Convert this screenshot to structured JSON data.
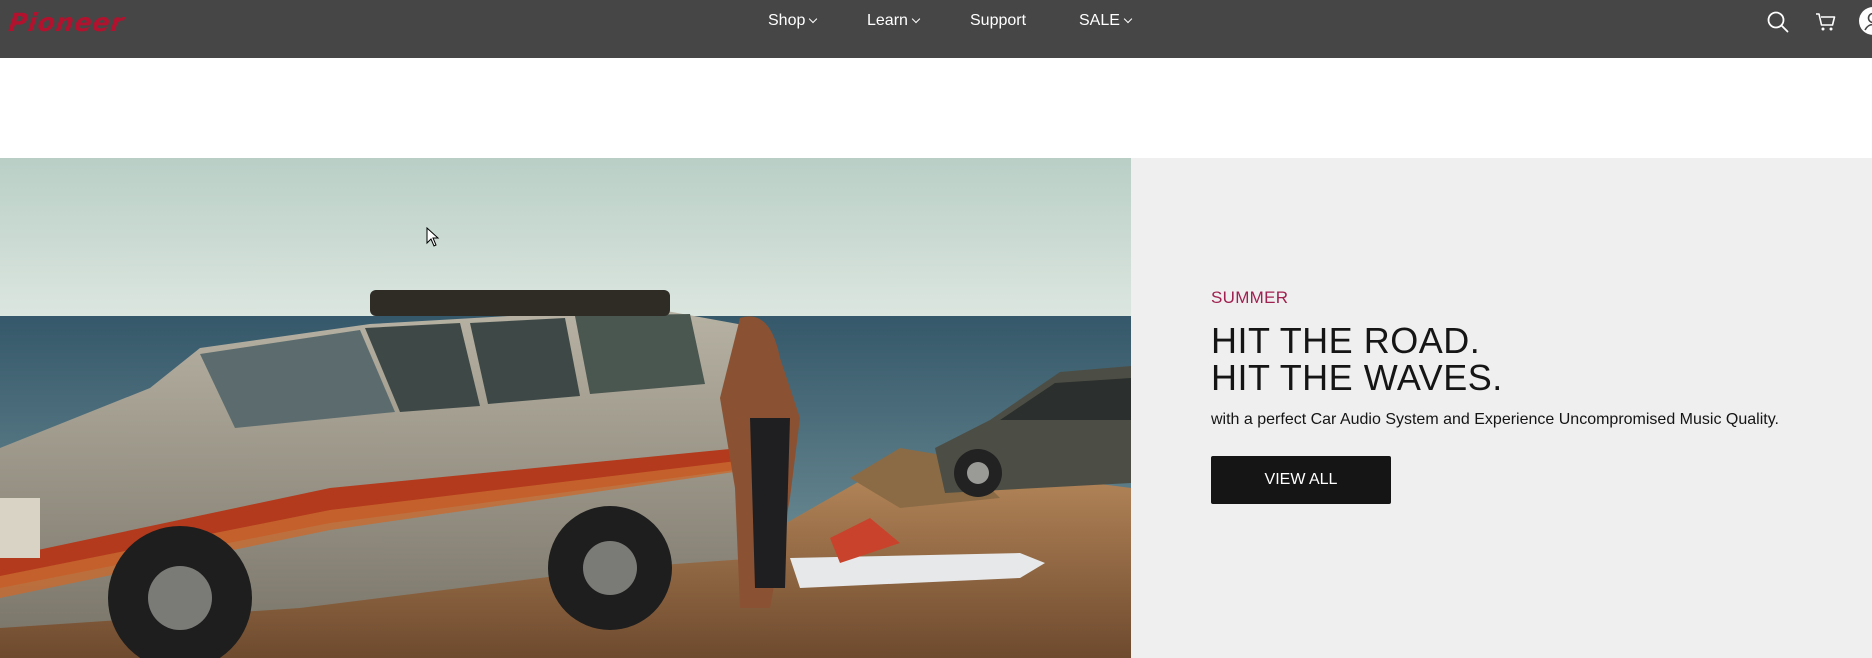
{
  "brand": {
    "logo_text": "Pioneer",
    "logo_color": "#b3122e"
  },
  "nav": {
    "items": [
      {
        "label": "Shop",
        "has_dropdown": true
      },
      {
        "label": "Learn",
        "has_dropdown": true
      },
      {
        "label": "Support",
        "has_dropdown": false
      },
      {
        "label": "SALE",
        "has_dropdown": true
      }
    ],
    "icons": [
      "search-icon",
      "cart-icon",
      "account-icon"
    ]
  },
  "hero": {
    "eyebrow": "SUMMER",
    "headline_line1": "HIT THE ROAD.",
    "headline_line2": "HIT THE WAVES.",
    "subtext": "with a perfect Car Audio System and Experience Uncompromised Music Quality.",
    "cta_label": "VIEW ALL",
    "accent_color": "#a0204f"
  },
  "colors": {
    "header_bg": "#464646",
    "panel_bg": "#efefef",
    "button_bg": "#151515"
  }
}
